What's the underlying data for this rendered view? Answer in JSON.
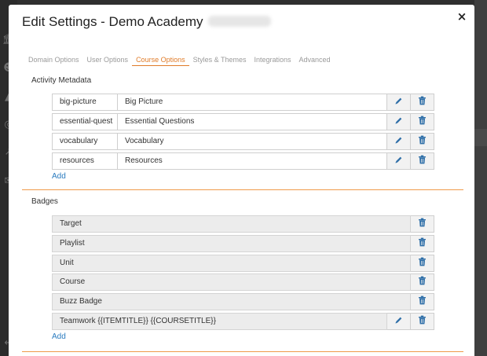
{
  "dialog": {
    "title": "Edit Settings - Demo Academy",
    "close_label": "×"
  },
  "tabs": [
    {
      "label": "Domain Options",
      "active": false
    },
    {
      "label": "User Options",
      "active": false
    },
    {
      "label": "Course Options",
      "active": true
    },
    {
      "label": "Styles & Themes",
      "active": false
    },
    {
      "label": "Integrations",
      "active": false
    },
    {
      "label": "Advanced",
      "active": false
    }
  ],
  "activity_metadata": {
    "heading": "Activity Metadata",
    "rows": [
      {
        "key": "big-picture",
        "value": "Big Picture"
      },
      {
        "key": "essential-quest",
        "value": "Essential Questions"
      },
      {
        "key": "vocabulary",
        "value": "Vocabulary"
      },
      {
        "key": "resources",
        "value": "Resources"
      }
    ],
    "add_label": "Add"
  },
  "badges": {
    "heading": "Badges",
    "rows": [
      {
        "name": "Target",
        "editable": false
      },
      {
        "name": "Playlist",
        "editable": false
      },
      {
        "name": "Unit",
        "editable": false
      },
      {
        "name": "Course",
        "editable": false
      },
      {
        "name": "Buzz Badge",
        "editable": false
      },
      {
        "name": "Teamwork {{ITEMTITLE}} {{COURSETITLE}}",
        "editable": true
      }
    ],
    "add_label": "Add"
  },
  "icons": {
    "edit": "pencil-icon",
    "delete": "trash-icon"
  },
  "colors": {
    "accent": "#e07b28",
    "link": "#2a7bbf",
    "icon": "#2f6fa8"
  }
}
